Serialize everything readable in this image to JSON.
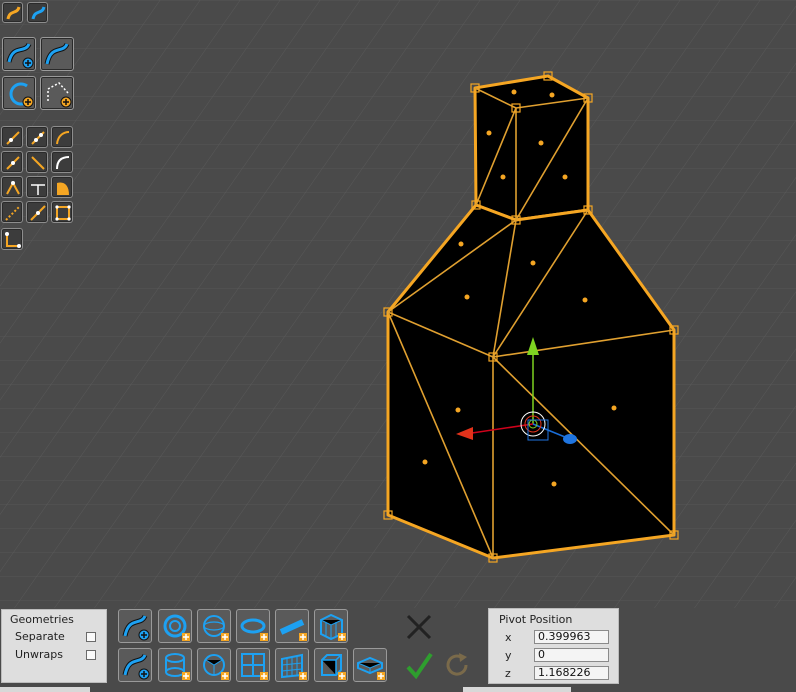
{
  "geometries_panel": {
    "title": "Geometries",
    "separate_label": "Separate",
    "unwraps_label": "Unwraps",
    "separate_checked": false,
    "unwraps_checked": false
  },
  "pivot_panel": {
    "title": "Pivot Position",
    "x_label": "x",
    "y_label": "y",
    "z_label": "z",
    "x_value": "0.399963",
    "y_value": "0",
    "z_value": "1.168226"
  },
  "colors": {
    "background": "#4a4a4a",
    "selection": "#f5a623",
    "accent_blue": "#1da1f2",
    "confirm_green": "#2e9e2e",
    "cancel_dark": "#222222"
  },
  "icons": {
    "confirm": "checkmark-icon",
    "cancel": "x-icon",
    "reset": "redo-icon"
  }
}
